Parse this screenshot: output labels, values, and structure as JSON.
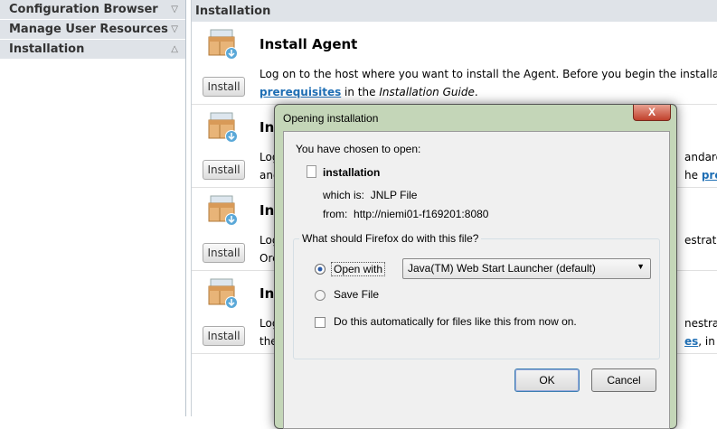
{
  "sidebar": {
    "items": [
      {
        "label": "Configuration Browser",
        "arrow": "▽"
      },
      {
        "label": "Manage User Resources",
        "arrow": "▽"
      },
      {
        "label": "Installation",
        "arrow": "△"
      }
    ]
  },
  "main": {
    "title": "Installation",
    "rows": [
      {
        "title": "Install Agent",
        "button": "Install",
        "line1": "Log on to the host where you want to install the Agent. Before you begin the installation,",
        "line2_link": "prerequisites",
        "line2_rest": " in the ",
        "line2_em": "Installation Guide",
        "line2_end": "."
      },
      {
        "title": "In",
        "button": "Install",
        "left1": "Log",
        "left2": "and",
        "right1": "andard",
        "right2_pre": "he ",
        "right2_link": "prer"
      },
      {
        "title": "In",
        "button": "Install",
        "left1": "Log",
        "left2": "Orc",
        "right1": "estrator",
        "right2_pre": "",
        "right2_link": ""
      },
      {
        "title": "In",
        "button": "Install",
        "left1": "Log",
        "left2": "the",
        "right1": "nestrator",
        "right2_pre": "",
        "right2_link": "es",
        "right2_post": ", in t"
      }
    ]
  },
  "dialog": {
    "title": "Opening installation",
    "close": "X",
    "chosen": "You have chosen to open:",
    "filename": "installation",
    "which_label": "which is:",
    "which_value": "JNLP File",
    "from_label": "from:",
    "from_value": "http://niemi01-f169201:8080",
    "question": "What should Firefox do with this file?",
    "open_with": "Open with",
    "app": "Java(TM) Web Start Launcher (default)",
    "save_file": "Save File",
    "auto": "Do this automatically for files like this from now on.",
    "ok": "OK",
    "cancel": "Cancel",
    "open_with_selected": true,
    "auto_checked": false
  }
}
